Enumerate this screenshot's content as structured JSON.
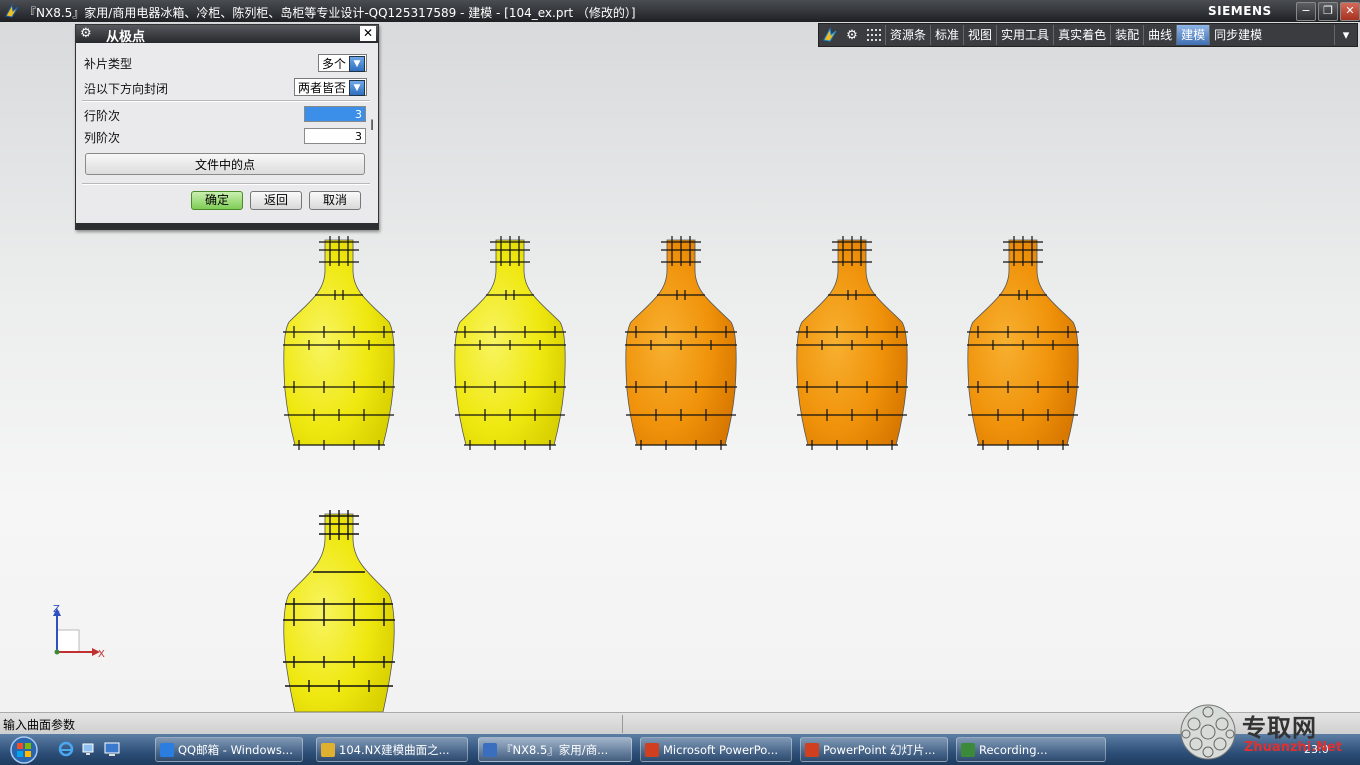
{
  "window": {
    "title": "『NX8.5』家用/商用电器冰箱、冷柜、陈列柜、岛柜等专业设计-QQ125317589 - 建模 - [104_ex.prt （修改的）]",
    "brand": "SIEMENS",
    "controls": [
      "−",
      "❐",
      "✕"
    ]
  },
  "ribbon": {
    "tabs": [
      "资源条",
      "标准",
      "视图",
      "实用工具",
      "真实着色",
      "装配",
      "曲线",
      "建模",
      "同步建模"
    ],
    "active_tab": "建模"
  },
  "dialog": {
    "title": "从极点",
    "patch_type_label": "补片类型",
    "patch_type_value": "多个",
    "close_along_label": "沿以下方向封闭",
    "close_along_value": "两者皆否",
    "row_degree_label": "行阶次",
    "row_degree_value": "3",
    "col_degree_label": "列阶次",
    "col_degree_value": "3",
    "points_from_file_label": "文件中的点",
    "ok_label": "确定",
    "back_label": "返回",
    "cancel_label": "取消"
  },
  "axes": {
    "z": "Z",
    "x": "X"
  },
  "status": {
    "text": "输入曲面参数"
  },
  "taskbar": {
    "items": [
      {
        "label": "QQ邮箱 - Windows...",
        "color": "#2b7de0"
      },
      {
        "label": "104.NX建模曲面之...",
        "color": "#e0b030"
      },
      {
        "label": "『NX8.5』家用/商...",
        "color": "#3a6fc0"
      },
      {
        "label": "Microsoft PowerPo...",
        "color": "#d04020"
      },
      {
        "label": "PowerPoint 幻灯片...",
        "color": "#d04020"
      },
      {
        "label": "Recording...",
        "color": "#3a8a3a"
      }
    ],
    "clock": "23:0"
  },
  "watermark": {
    "text": "专取网",
    "url": "Zhuanzhi.Net"
  },
  "colors": {
    "yellow": "#f2ee1a",
    "orange": "#f29a10"
  }
}
